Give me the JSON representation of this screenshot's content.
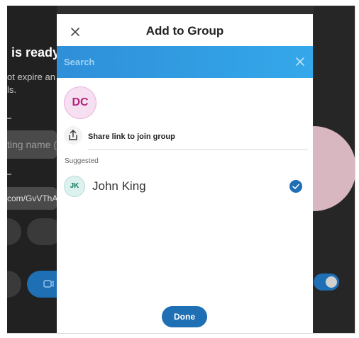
{
  "background": {
    "heading": "is ready",
    "subtext_line1": "ot expire an",
    "subtext_line2": "ls.",
    "name_field_partial": "ting name (o",
    "link_partial": "com/GvVThAr",
    "accent_color": "#1f6fb5"
  },
  "dialog": {
    "title": "Add to Group",
    "close_icon": "close-icon",
    "search": {
      "placeholder": "Search",
      "clear_icon": "clear-icon"
    },
    "selected_chips": [
      {
        "initials": "DC"
      }
    ],
    "share": {
      "label": "Share link to join group",
      "icon": "share-icon"
    },
    "suggested_label": "Suggested",
    "contacts": [
      {
        "initials": "JK",
        "name": "John King",
        "selected": true
      }
    ],
    "done_label": "Done"
  }
}
